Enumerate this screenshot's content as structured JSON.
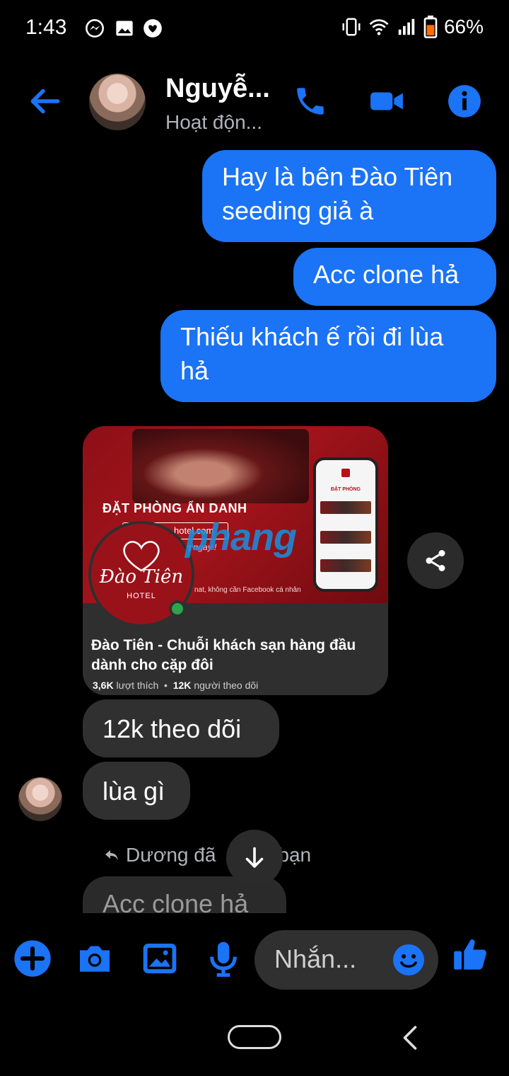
{
  "status_bar": {
    "time": "1:43",
    "battery": "66%",
    "icons": [
      "messenger-icon",
      "image-icon",
      "heart-chat-icon",
      "vibrate-icon",
      "wifi-icon",
      "signal-icon",
      "battery-icon"
    ]
  },
  "header": {
    "contact_name": "Nguyễ...",
    "presence": "Hoạt độn...",
    "actions": [
      "back-arrow-icon",
      "phone-icon",
      "video-icon",
      "info-icon"
    ],
    "accent_color": "#1b73f6"
  },
  "messages": {
    "out1": [
      "Hay là bên Đào Tiên",
      "seeding giả à"
    ],
    "out2": "Acc clone hả",
    "out3": [
      "Thiếu khách ế rồi đi lùa",
      "hả"
    ],
    "in1": "12k theo dõi",
    "in2": "lùa gì",
    "reply_note": "Dương đã",
    "reply_note_tail": "bạn",
    "reply_quote": "Acc clone hả"
  },
  "link_card": {
    "headline": "ĐẶT PHÒNG ẨN DANH",
    "url_fragment": "hotel.com",
    "promo_fragment": "ng ngay !",
    "footer_fragment": "nat, không cần Facebook cá nhân",
    "phone_title": "ĐẶT PHÒNG",
    "logo_text": "Đào Tiên",
    "logo_sub": "HOTEL",
    "title": "Đào Tiên - Chuỗi khách sạn hàng đầu dành cho cặp đôi",
    "likes_value": "3,6K",
    "likes_label": "lượt thích",
    "followers_value": "12K",
    "followers_label": "người theo dõi",
    "watermark": "phang"
  },
  "composer": {
    "placeholder": "Nhắn...",
    "icons": [
      "add-icon",
      "camera-icon",
      "gallery-icon",
      "microphone-icon",
      "emoji-icon",
      "like-icon"
    ]
  }
}
